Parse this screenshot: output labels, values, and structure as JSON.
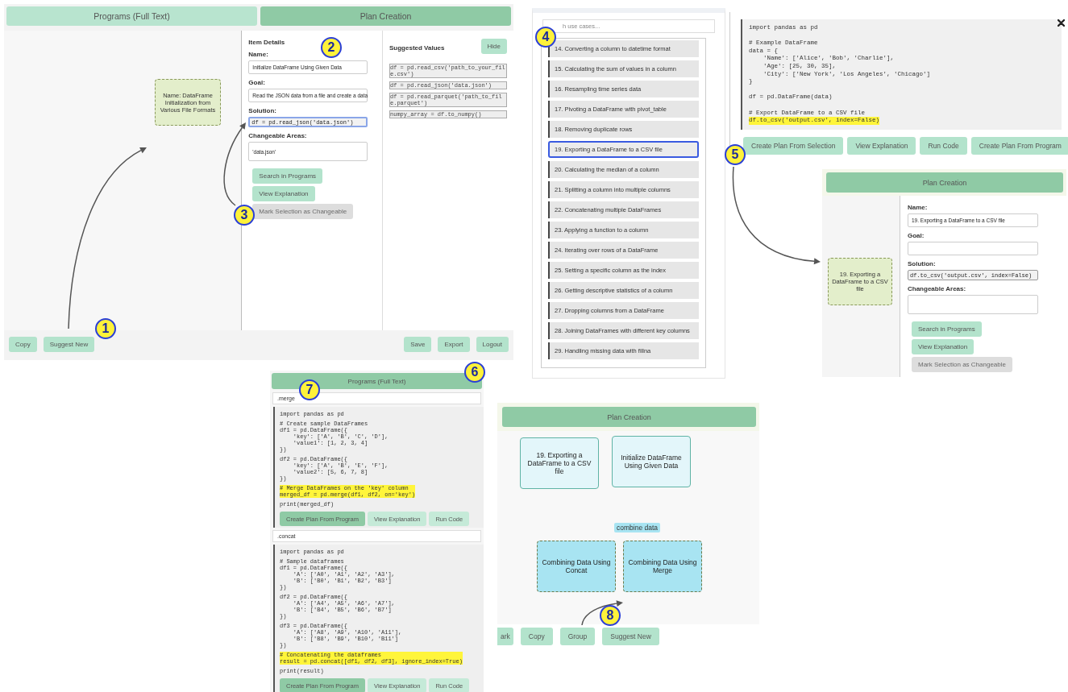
{
  "main_screen": {
    "tabs": [
      {
        "label": "Programs (Full Text)",
        "selected": false
      },
      {
        "label": "Plan Creation",
        "selected": true
      }
    ],
    "node": "Name: DataFrame Initialization from Various File Formats",
    "details_title": "Item Details",
    "fields": [
      {
        "label": "Name:",
        "value": "Initialize DataFrame Using Given Data",
        "kind": "text",
        "focused": false
      },
      {
        "label": "Goal:",
        "value": "Read the JSON data from a file and create a data",
        "kind": "text",
        "focused": false
      },
      {
        "label": "Solution:",
        "value": "df = pd.read_json('data.json')",
        "kind": "code",
        "focused": true
      },
      {
        "label": "Changeable Areas:",
        "value": "'data.json'",
        "kind": "area",
        "focused": false
      }
    ],
    "actions": [
      {
        "label": "Search in Programs",
        "disabled": false
      },
      {
        "label": "View Explanation",
        "disabled": false
      },
      {
        "label": "Mark Selection as Changeable",
        "disabled": true
      }
    ],
    "suggested_title": "Suggested Values",
    "hide_button": "Hide",
    "suggested_values": [
      "df = pd.read_csv('path_to_your_file.csv')",
      "df = pd.read_json('data.json')",
      "df = pd.read_parquet('path_to_file.parquet')",
      "numpy_array = df.to_numpy()"
    ],
    "footer_left": [
      "Copy",
      "Suggest New"
    ],
    "footer_right": [
      "Save",
      "Export",
      "Logout"
    ]
  },
  "use_case_list": {
    "search_placeholder": "h use cases...",
    "items": [
      {
        "label": "14. Converting a column to datetime format",
        "selected": false
      },
      {
        "label": "15. Calculating the sum of values in a column",
        "selected": false
      },
      {
        "label": "16. Resampling time series data",
        "selected": false
      },
      {
        "label": "17. Pivoting a DataFrame with pivot_table",
        "selected": false
      },
      {
        "label": "18. Removing duplicate rows",
        "selected": false
      },
      {
        "label": "19. Exporting a DataFrame to a CSV file",
        "selected": true
      },
      {
        "label": "20. Calculating the median of a column",
        "selected": false
      },
      {
        "label": "21. Splitting a column into multiple columns",
        "selected": false
      },
      {
        "label": "22. Concatenating multiple DataFrames",
        "selected": false
      },
      {
        "label": "23. Applying a function to a column",
        "selected": false
      },
      {
        "label": "24. Iterating over rows of a DataFrame",
        "selected": false
      },
      {
        "label": "25. Setting a specific column as the index",
        "selected": false
      },
      {
        "label": "26. Getting descriptive statistics of a column",
        "selected": false
      },
      {
        "label": "27. Dropping columns from a DataFrame",
        "selected": false
      },
      {
        "label": "28. Joining DataFrames with different key columns",
        "selected": false
      },
      {
        "label": "29. Handling missing data with fillna",
        "selected": false
      }
    ]
  },
  "code_view": {
    "code": [
      {
        "kind": "text",
        "text": "import pandas as pd",
        "highlight": false
      },
      {
        "kind": "blank"
      },
      {
        "kind": "text",
        "text": "# Example DataFrame\ndata = {\n    'Name': ['Alice', 'Bob', 'Charlie'],\n    'Age': [25, 30, 35],\n    'City': ['New York', 'Los Angeles', 'Chicago']\n}",
        "highlight": false
      },
      {
        "kind": "blank"
      },
      {
        "kind": "text",
        "text": "df = pd.DataFrame(data)",
        "highlight": false
      },
      {
        "kind": "blank"
      },
      {
        "kind": "text",
        "text": "# Export DataFrame to a CSV file",
        "highlight": false
      },
      {
        "kind": "text",
        "text": "df.to_csv('output.csv', index=False)",
        "highlight": true
      }
    ],
    "buttons": [
      "Create Plan From Selection",
      "View Explanation",
      "Run Code",
      "Create Plan From Program"
    ]
  },
  "plan_form": {
    "header": "Plan Creation",
    "node": "19. Exporting a DataFrame to a CSV file",
    "fields": [
      {
        "label": "Name:",
        "value": "19. Exporting a DataFrame to a CSV file",
        "kind": "text",
        "focused": false
      },
      {
        "label": "Goal:",
        "kind": "text",
        "focused": false
      },
      {
        "label": "Solution:",
        "value": "df.to_csv('output.csv', index=False)",
        "kind": "code",
        "focused": false
      },
      {
        "label": "Changeable Areas:",
        "kind": "area",
        "focused": false
      }
    ],
    "actions": [
      {
        "label": "Search in Programs",
        "disabled": false
      },
      {
        "label": "View Explanation",
        "disabled": false
      },
      {
        "label": "Mark Selection as Changeable",
        "disabled": true
      }
    ]
  },
  "programs_panel": {
    "header": "Programs (Full Text)",
    "programs": [
      {
        "query": ".merge",
        "code": [
          {
            "kind": "text",
            "text": "import pandas as pd",
            "highlight": false
          },
          {
            "kind": "blank"
          },
          {
            "kind": "text",
            "text": "# Create sample DataFrames\ndf1 = pd.DataFrame({\n    'key': ['A', 'B', 'C', 'D'],\n    'value1': [1, 2, 3, 4]\n})",
            "highlight": false
          },
          {
            "kind": "blank"
          },
          {
            "kind": "text",
            "text": "df2 = pd.DataFrame({\n    'key': ['A', 'B', 'E', 'F'],\n    'value2': [5, 6, 7, 8]\n})",
            "highlight": false
          },
          {
            "kind": "blank"
          },
          {
            "kind": "text",
            "text": "# Merge DataFrames on the 'key' column\nmerged_df = pd.merge(df1, df2, on='key')",
            "highlight": true
          },
          {
            "kind": "blank"
          },
          {
            "kind": "text",
            "text": "print(merged_df)",
            "highlight": false
          }
        ],
        "buttons": [
          {
            "label": "Create Plan From Program",
            "primary": true
          },
          {
            "label": "View Explanation",
            "primary": false
          },
          {
            "label": "Run Code",
            "primary": false
          }
        ]
      },
      {
        "query": ".concat",
        "code": [
          {
            "kind": "text",
            "text": "import pandas as pd",
            "highlight": false
          },
          {
            "kind": "blank"
          },
          {
            "kind": "text",
            "text": "# Sample dataframes\ndf1 = pd.DataFrame({\n    'A': ['A0', 'A1', 'A2', 'A3'],\n    'B': ['B0', 'B1', 'B2', 'B3']\n})",
            "highlight": false
          },
          {
            "kind": "blank"
          },
          {
            "kind": "text",
            "text": "df2 = pd.DataFrame({\n    'A': ['A4', 'A5', 'A6', 'A7'],\n    'B': ['B4', 'B5', 'B6', 'B7']\n})",
            "highlight": false
          },
          {
            "kind": "blank"
          },
          {
            "kind": "text",
            "text": "df3 = pd.DataFrame({\n    'A': ['A8', 'A9', 'A10', 'A11'],\n    'B': ['B8', 'B9', 'B10', 'B11']\n})",
            "highlight": false
          },
          {
            "kind": "blank"
          },
          {
            "kind": "text",
            "text": "# Concatenating the dataframes\nresult = pd.concat([df1, df2, df3], ignore_index=True)",
            "highlight": true
          },
          {
            "kind": "blank"
          },
          {
            "kind": "text",
            "text": "print(result)",
            "highlight": false
          }
        ],
        "buttons": [
          {
            "label": "Create Plan From Program",
            "primary": true
          },
          {
            "label": "View Explanation",
            "primary": false
          },
          {
            "label": "Run Code",
            "primary": false
          }
        ]
      }
    ]
  },
  "plan_canvas": {
    "header": "Plan Creation",
    "nodes": [
      {
        "text": "19. Exporting a DataFrame to a CSV file",
        "kind": "solid"
      },
      {
        "text": "Initialize DataFrame Using Given Data",
        "kind": "solid"
      },
      {
        "text": "Combining Data Using Concat",
        "kind": "dashed"
      },
      {
        "text": "Combining Data Using Merge",
        "kind": "dashed"
      }
    ],
    "group_label": "combine data",
    "buttons": [
      "ark",
      "Copy",
      "Group",
      "Suggest New"
    ]
  },
  "callouts": [
    "1",
    "2",
    "3",
    "4",
    "5",
    "6",
    "7",
    "8"
  ]
}
